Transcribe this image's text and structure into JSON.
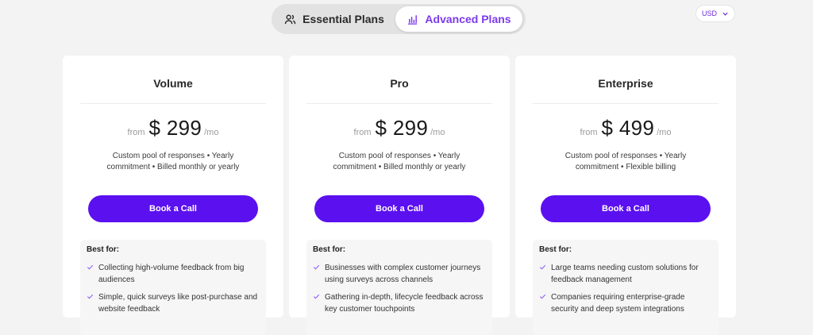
{
  "toggle": {
    "essential_label": "Essential Plans",
    "advanced_label": "Advanced Plans",
    "essential_icon": "users-icon",
    "advanced_icon": "chart-icon",
    "active": "advanced"
  },
  "currency": {
    "selected": "USD",
    "icon": "chevron-down-icon"
  },
  "colors": {
    "accent": "#5b10f0",
    "accent_text": "#7c3aed",
    "background": "#f3f3f3"
  },
  "plans": [
    {
      "name": "Volume",
      "from": "from",
      "price": "$ 299",
      "period": "/mo",
      "description": "Custom pool of responses • Yearly commitment • Billed monthly or yearly",
      "cta": "Book a Call",
      "best_for_title": "Best for:",
      "best_for": [
        "Collecting high-volume feedback from big audiences",
        "Simple, quick surveys like post-purchase and website feedback"
      ]
    },
    {
      "name": "Pro",
      "from": "from",
      "price": "$ 299",
      "period": "/mo",
      "description": "Custom pool of responses • Yearly commitment • Billed monthly or yearly",
      "cta": "Book a Call",
      "best_for_title": "Best for:",
      "best_for": [
        "Businesses with complex customer journeys using surveys across channels",
        "Gathering in-depth, lifecycle feedback across key customer touchpoints"
      ]
    },
    {
      "name": "Enterprise",
      "from": "from",
      "price": "$ 499",
      "period": "/mo",
      "description": "Custom pool of responses • Yearly commitment • Flexible billing",
      "cta": "Book a Call",
      "best_for_title": "Best for:",
      "best_for": [
        "Large teams needing custom solutions for feedback management",
        "Companies requiring enterprise-grade security and deep system integrations"
      ]
    }
  ]
}
